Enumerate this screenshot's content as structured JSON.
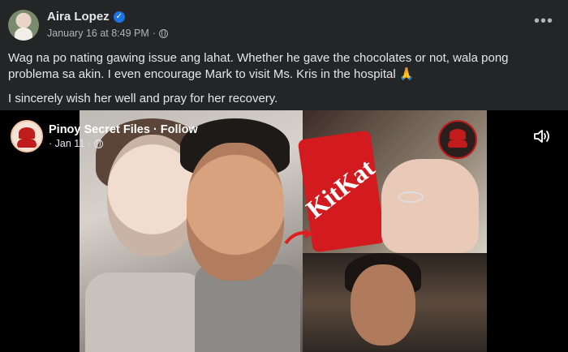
{
  "post": {
    "author": "Aira Lopez",
    "date": "January 16 at 8:49 PM",
    "separator": "·",
    "more_label": "•••",
    "paragraph1": "Wag na po nating gawing issue ang lahat. Whether he gave the chocolates or not, wala pong problema sa akin. I even encourage Mark to visit Ms. Kris in the hospital 🙏",
    "paragraph2": "I sincerely wish her well and pray for her recovery."
  },
  "shared": {
    "page_name": "Pinoy Secret Files · Follow",
    "date": "· Jan 11 ·",
    "kitkat_text": "KitKat"
  },
  "icons": {
    "verified": "verified-badge-icon",
    "privacy": "globe-icon",
    "more": "more-options-icon",
    "volume": "volume-icon"
  },
  "colors": {
    "background": "#242526",
    "verified": "#1b74e4",
    "brand_red": "#c21b1b"
  }
}
